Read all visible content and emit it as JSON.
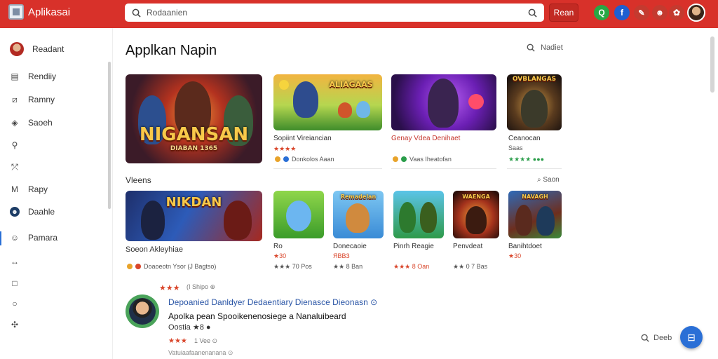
{
  "app": {
    "name": "Aplikasai"
  },
  "search": {
    "value": "Rodaanien"
  },
  "header": {
    "search_button": "Rean"
  },
  "sidebar": {
    "items": [
      {
        "label": "Readant",
        "icon": "avatar"
      },
      {
        "label": "Rendiiy",
        "icon": "calendar-icon"
      },
      {
        "label": "Ramny",
        "icon": "chart-icon"
      },
      {
        "label": "Saoeh",
        "icon": "tag-icon"
      },
      {
        "label": "",
        "icon": "wrench-icon"
      },
      {
        "label": "",
        "icon": "shield-icon"
      },
      {
        "label": "Rapy",
        "icon": "mail-icon"
      },
      {
        "label": "Daahle",
        "icon": "globe-icon"
      },
      {
        "label": "Pamara",
        "icon": "smiley-icon"
      },
      {
        "label": "",
        "icon": "arrows-icon"
      },
      {
        "label": "",
        "icon": "square-icon"
      },
      {
        "label": "",
        "icon": "search-icon"
      },
      {
        "label": "",
        "icon": "gear-icon"
      }
    ]
  },
  "main": {
    "title": "Applkan Napin",
    "top_search": "Nadiet",
    "featured": [
      {
        "art_text": "NIGANSAN",
        "art_sub": "DIABAN 1365",
        "title": "",
        "rating": "",
        "meta": ""
      },
      {
        "art_text": "ALIAGAAS",
        "title": "Sopiint Vireiancian",
        "rating": "★★★★",
        "meta": "Donkolos Aaan"
      },
      {
        "art_text": "",
        "title": "Genay Vdea Denihaet",
        "rating": "",
        "meta": "Vaas Iheatofan"
      },
      {
        "art_text": "OVBLANGAS",
        "title": "Ceanocan",
        "rating": "Saas",
        "meta": "★★★★ ●●●"
      }
    ],
    "section_label": "Vleens",
    "section_link": "Saon",
    "row2": [
      {
        "art_text": "NIKDAN",
        "title": "Soeon Akleyhiae",
        "rating": "",
        "meta": "Doaoeotn Ysor (J Bagtso)"
      },
      {
        "art_text": "",
        "title": "Ro",
        "rating": "★30",
        "meta": "★★★ 70 Pos"
      },
      {
        "art_text": "Remadelan",
        "title": "Donecaoie",
        "rating": "ЯВВЗ",
        "meta": "★★ 8 Ban"
      },
      {
        "art_text": "",
        "title": "Pinrh Reagie",
        "rating": "★★★ 8 Oan",
        "meta": ""
      },
      {
        "art_text": "WAENGA",
        "title": "Penvdeat",
        "rating": "",
        "meta": "★★ 0 7 Bas"
      },
      {
        "art_text": "NAVAGH",
        "title": "Banihtdoet",
        "rating": "★30",
        "meta": ""
      }
    ],
    "review": {
      "stars": "★★★",
      "stars_meta": "(I Shipo ⊕",
      "title": "Depoanied Danldyer Dedaentiary Dienasce Dieonasn ⊙",
      "line1": "Apolka pean Spooikenenosiege a Nanaluibeard",
      "line2": "Oostia ★8 ●",
      "foot_stars": "★★★",
      "foot_meta": "1 Vee ⊙",
      "foot_text": "Vatuiaafaanenanana ⊙"
    },
    "bottom_search": "Deeb"
  },
  "colors": {
    "topbar": "#d8312a",
    "accent": "#2a6fd6",
    "link": "#2b56a6"
  }
}
